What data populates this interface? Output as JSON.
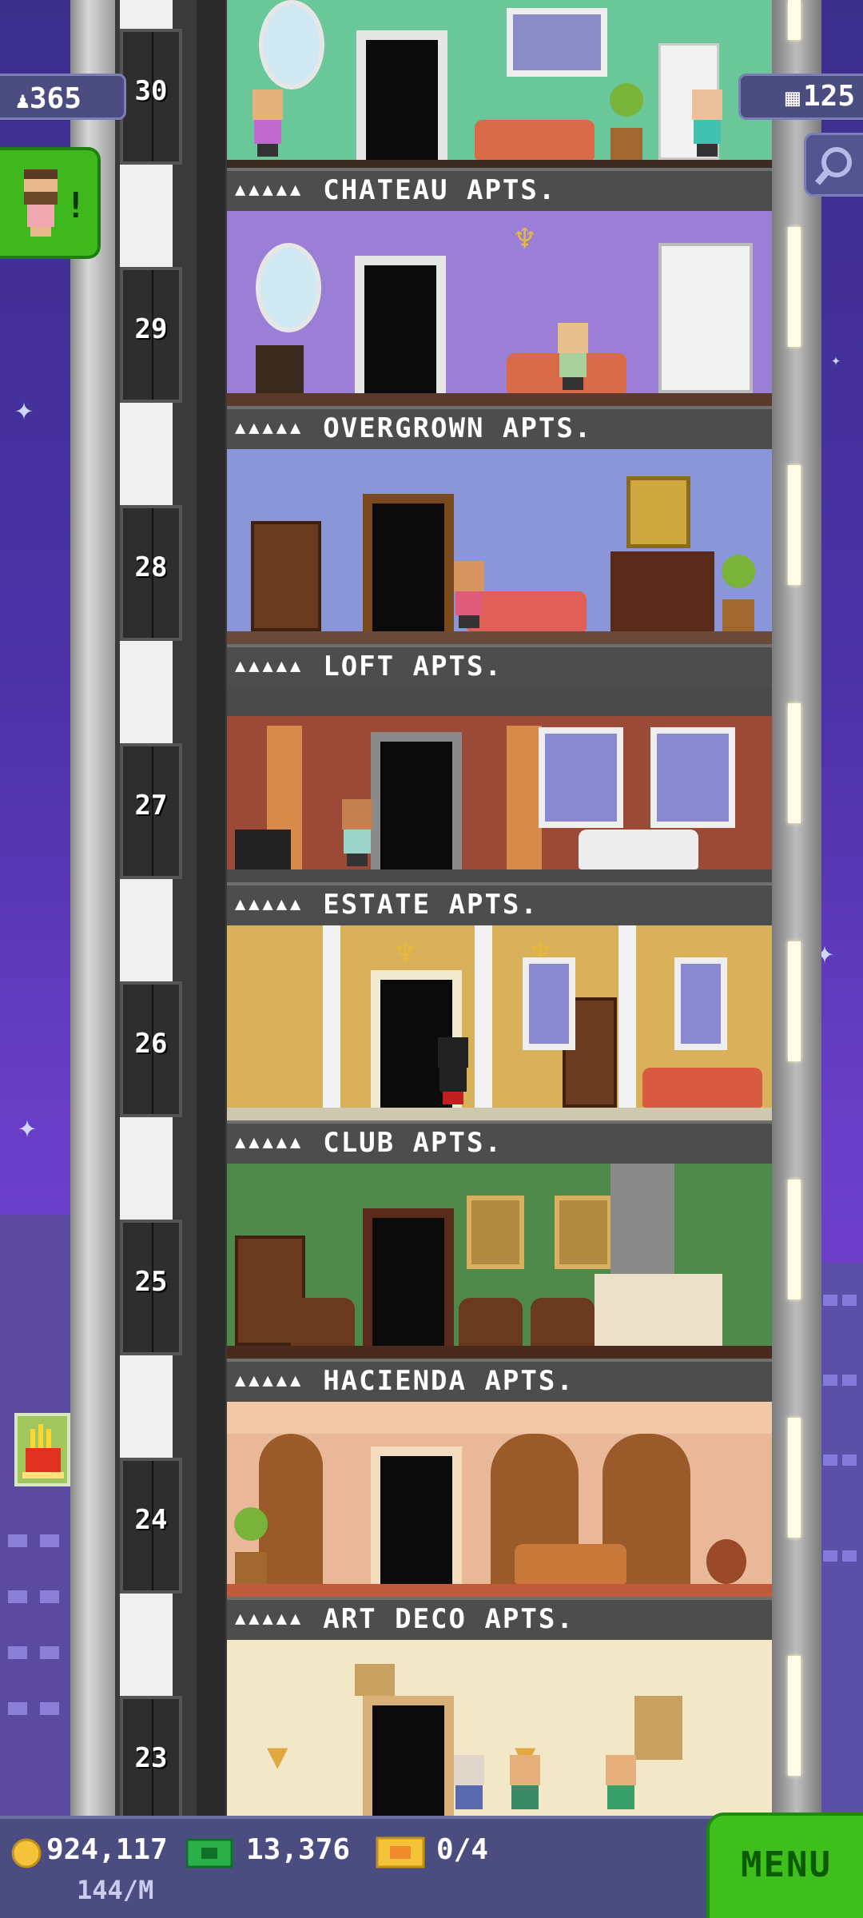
{
  "hud": {
    "population": "365",
    "bux_count": "125"
  },
  "floors": [
    {
      "number": "30",
      "name": "CHATEAU APTS."
    },
    {
      "number": "29",
      "name": "OVERGROWN APTS."
    },
    {
      "number": "28",
      "name": "LOFT APTS."
    },
    {
      "number": "27",
      "name": "ESTATE APTS."
    },
    {
      "number": "26",
      "name": "CLUB APTS."
    },
    {
      "number": "25",
      "name": "HACIENDA APTS."
    },
    {
      "number": "24",
      "name": "ART DECO APTS."
    },
    {
      "number": "23",
      "name": ""
    }
  ],
  "footer": {
    "coins": "924,117",
    "coins_rate": "144/M",
    "bux": "13,376",
    "tickets": "0/4",
    "menu_label": "MENU"
  },
  "colors": {
    "accent_green": "#3fbf1c",
    "hud_bg": "#4b4d80"
  }
}
